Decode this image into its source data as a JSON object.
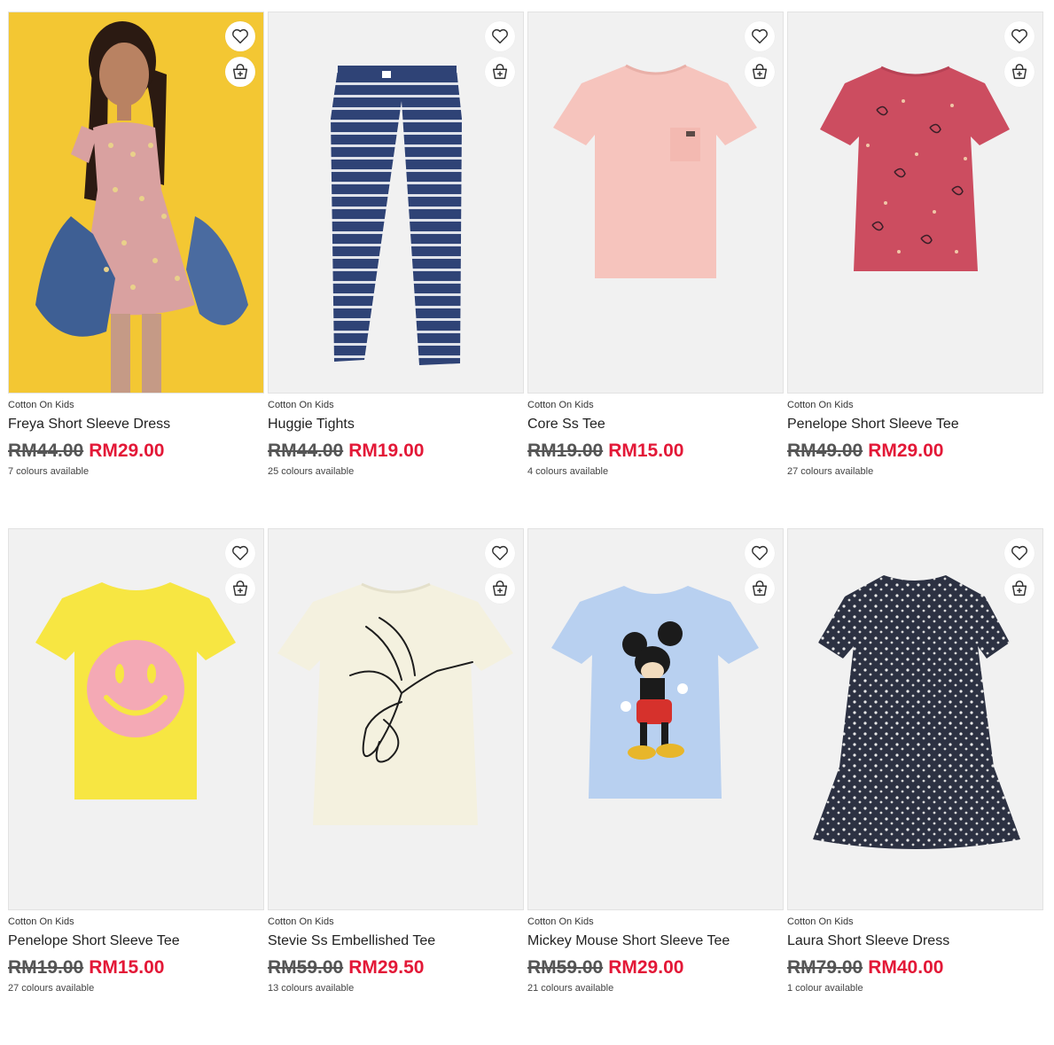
{
  "products": [
    {
      "brand": "Cotton On Kids",
      "name": "Freya Short Sleeve Dress",
      "old_price": "RM44.00",
      "price": "RM29.00",
      "colours": "7 colours available",
      "image": "girl-pink-dress-photo"
    },
    {
      "brand": "Cotton On Kids",
      "name": "Huggie Tights",
      "old_price": "RM44.00",
      "price": "RM19.00",
      "colours": "25 colours available",
      "image": "navy-striped-tights"
    },
    {
      "brand": "Cotton On Kids",
      "name": "Core Ss Tee",
      "old_price": "RM19.00",
      "price": "RM15.00",
      "colours": "4 colours available",
      "image": "pink-pocket-tee"
    },
    {
      "brand": "Cotton On Kids",
      "name": "Penelope Short Sleeve Tee",
      "old_price": "RM49.00",
      "price": "RM29.00",
      "colours": "27 colours available",
      "image": "red-paisley-tee"
    },
    {
      "brand": "Cotton On Kids",
      "name": "Penelope Short Sleeve Tee",
      "old_price": "RM19.00",
      "price": "RM15.00",
      "colours": "27 colours available",
      "image": "yellow-smiley-tee"
    },
    {
      "brand": "Cotton On Kids",
      "name": "Stevie Ss Embellished Tee",
      "old_price": "RM59.00",
      "price": "RM29.50",
      "colours": "13 colours available",
      "image": "cream-bird-tee"
    },
    {
      "brand": "Cotton On Kids",
      "name": "Mickey Mouse Short Sleeve Tee",
      "old_price": "RM59.00",
      "price": "RM29.00",
      "colours": "21 colours available",
      "image": "blue-mickey-tee"
    },
    {
      "brand": "Cotton On Kids",
      "name": "Laura Short Sleeve Dress",
      "old_price": "RM79.00",
      "price": "RM40.00",
      "colours": "1 colour available",
      "image": "navy-floral-dress"
    }
  ],
  "icons": {
    "wishlist": "heart-icon",
    "add_to_bag": "bag-plus-icon"
  },
  "colors": {
    "sale": "#e31837",
    "card_bg": "#f1f1f1"
  }
}
